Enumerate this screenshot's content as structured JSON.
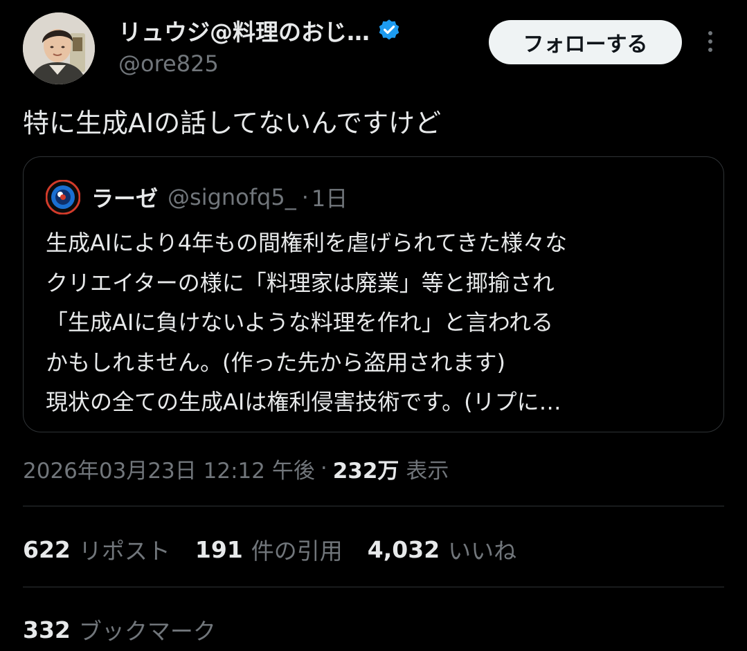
{
  "author": {
    "display_name": "リュウジ@料理のおじ…",
    "handle": "@ore825",
    "verified": true,
    "avatar": "profile-photo"
  },
  "follow_button": {
    "label": "フォローする"
  },
  "more_menu": {
    "icon": "more-vertical-icon"
  },
  "tweet": {
    "text": "特に生成AIの話してないんですけど"
  },
  "quoted_tweet": {
    "display_name": "ラーゼ",
    "handle": "@signofq5_",
    "separator": "·",
    "time": "1日",
    "lines": [
      "生成AIにより4年もの間権利を虐げられてきた様々な",
      "クリエイターの様に「料理家は廃業」等と揶揄され",
      "「生成AIに負けないような料理を作れ」と言われる",
      "かもしれません。(作った先から盗用されます)",
      "現状の全ての生成AIは権利侵害技術です。(リプに…"
    ]
  },
  "meta": {
    "timestamp": "2026年03月23日 12:12 午後",
    "separator": "·",
    "views_count": "232万",
    "views_label": "表示"
  },
  "stats": {
    "reposts_count": "622",
    "reposts_label": "リポスト",
    "quotes_count": "191",
    "quotes_label": "件の引用",
    "likes_count": "4,032",
    "likes_label": "いいね",
    "bookmarks_count": "332",
    "bookmarks_label": "ブックマーク"
  },
  "colors": {
    "background": "#000000",
    "primary_text": "#e7e9ea",
    "secondary_text": "#71767b",
    "border": "#2f3336",
    "verified_blue": "#1d9bf0",
    "follow_bg": "#eff3f4"
  }
}
